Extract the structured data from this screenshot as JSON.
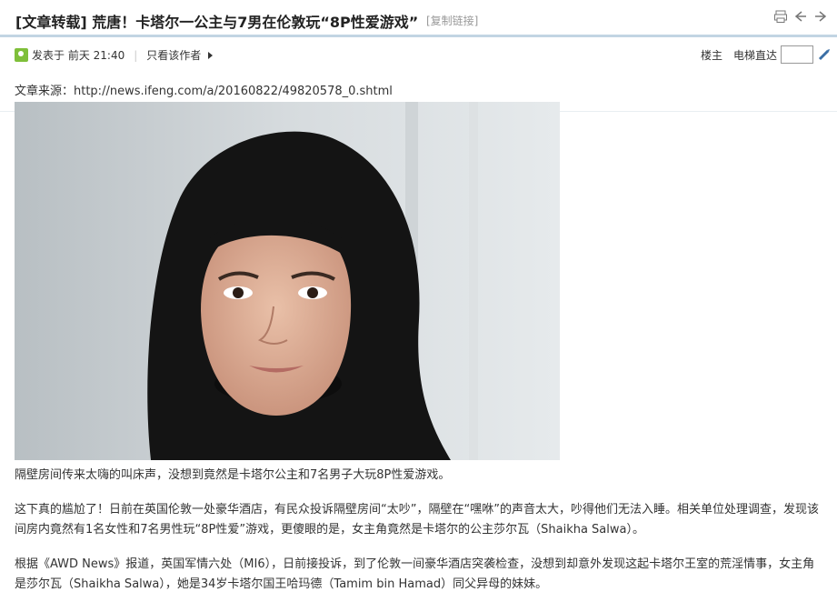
{
  "post": {
    "title": "[文章转载] 荒唐！卡塔尔一公主与7男在伦敦玩“8P性爱游戏”",
    "copy_link": "[复制链接]"
  },
  "toolbar": {
    "icons": [
      "print-icon",
      "prev-thread-icon",
      "next-thread-icon"
    ]
  },
  "meta": {
    "posted": "发表于 前天 21:40",
    "author_only": "只看该作者",
    "floor": "楼主",
    "elevator": "电梯直达",
    "elevator_value": ""
  },
  "content": {
    "source": "文章来源：http://news.ifeng.com/a/20160822/49820578_0.shtml",
    "caption": "隔壁房间传来太嗨的叫床声，没想到竟然是卡塔尔公主和7名男子大玩8P性爱游戏。",
    "para1": "这下真的尴尬了！日前在英国伦敦一处豪华酒店，有民众投诉隔壁房间“太吵”，隔壁在“嘿咻”的声音太大，吵得他们无法入睡。相关单位处理调查，发现该间房内竟然有1名女性和7名男性玩“8P性爱”游戏，更傻眼的是，女主角竟然是卡塔尔的公主莎尔瓦（Shaikha Salwa）。",
    "para2": "根据《AWD News》报道，英国军情六处（MI6），日前接投诉，到了伦敦一间豪华酒店突袭检查，没想到却意外发现这起卡塔尔王室的荒淫情事，女主角是莎尔瓦（Shaikha Salwa），她是34岁卡塔尔国王哈玛德（Tamim bin Hamad）同父异母的妹妹。"
  },
  "colors": {
    "rule": "#c2d5e3",
    "online": "#7fbf3a",
    "link_gray": "#999999"
  }
}
